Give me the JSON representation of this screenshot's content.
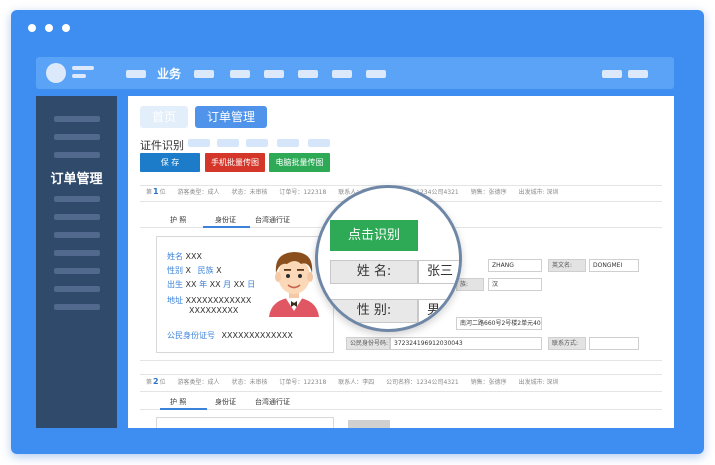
{
  "topnav": {
    "menu_label": "业务"
  },
  "sidebar": {
    "active_label": "订单管理"
  },
  "tabs": {
    "home": "首页",
    "order": "订单管理"
  },
  "section": {
    "title": "证件识别"
  },
  "buttons": {
    "save": "保 存",
    "phone_upload": "手机批量传图",
    "pc_upload": "电脑批量传图"
  },
  "colors": {
    "window": "#3d8ef0",
    "sidebar": "#2f4a6b",
    "save": "#1c7cc9",
    "phone_upload": "#d4372a",
    "pc_upload": "#2eaa57"
  },
  "record1": {
    "no_prefix": "第",
    "no": "1",
    "no_suffix": "位",
    "guest_type": "游客类型：成人",
    "status": "状态：未审核",
    "order_no": "订单号：122318",
    "contact": "联系人：李四",
    "company": "公司名称：1234公司4321",
    "sales": "销售：张德序",
    "departure": "出发城市: 深圳",
    "doc_tabs": [
      "护 照",
      "身份证",
      "台湾通行证"
    ],
    "id_card": {
      "name_key": "姓名",
      "name_val": "XXX",
      "gender_key": "性别",
      "gender_val": "X",
      "ethnic_key": "民族",
      "ethnic_val": "X",
      "birth_key": "出生",
      "birth_y": "XX",
      "year": "年",
      "birth_m": "XX",
      "month": "月",
      "birth_d": "XX",
      "day": "日",
      "address_key": "地址",
      "address_val1": "XXXXXXXXXXXX",
      "address_val2": "XXXXXXXXX",
      "idno_key": "公民身份证号",
      "idno_val": "XXXXXXXXXXXXX"
    },
    "fields": {
      "pinyin_surname_value": "ZHANG",
      "en_name_label": "英文名:",
      "en_name_value": "DONGMEI",
      "ethnic_label": "族:",
      "ethnic_value": "汉",
      "address_value": "南河二路660号2号楼2单元402室",
      "idno_label": "公民身份号码:",
      "idno_value": "372324196912030043",
      "contact_label": "联系方式:"
    }
  },
  "record2": {
    "no_prefix": "第",
    "no": "2",
    "no_suffix": "位",
    "guest_type": "游客类型：成人",
    "status": "状态：未审核",
    "order_no": "订单号：122318",
    "contact": "联系人：李四",
    "company": "公司名称：1234公司4321",
    "sales": "销售：张德序",
    "departure": "出发城市: 深圳",
    "doc_tabs": [
      "护 照",
      "身份证",
      "台湾通行证"
    ]
  },
  "magnifier": {
    "recognize_button": "点击识别",
    "name_label": "姓 名:",
    "name_value": "张三",
    "gender_label": "性 别:",
    "gender_value": "男"
  }
}
